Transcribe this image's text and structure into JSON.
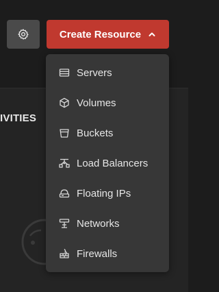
{
  "toolbar": {
    "settings_icon": "gear-icon",
    "create_label": "Create Resource",
    "create_icon": "chevron-up-icon",
    "accent_color": "#c0392f"
  },
  "background_panel": {
    "heading": "IVITIES"
  },
  "menu": {
    "items": [
      {
        "label": "Servers",
        "icon": "server-icon"
      },
      {
        "label": "Volumes",
        "icon": "cube-icon"
      },
      {
        "label": "Buckets",
        "icon": "bucket-icon"
      },
      {
        "label": "Load Balancers",
        "icon": "load-balancer-icon"
      },
      {
        "label": "Floating IPs",
        "icon": "floating-ip-icon"
      },
      {
        "label": "Networks",
        "icon": "network-icon"
      },
      {
        "label": "Firewalls",
        "icon": "firewall-icon"
      }
    ]
  }
}
